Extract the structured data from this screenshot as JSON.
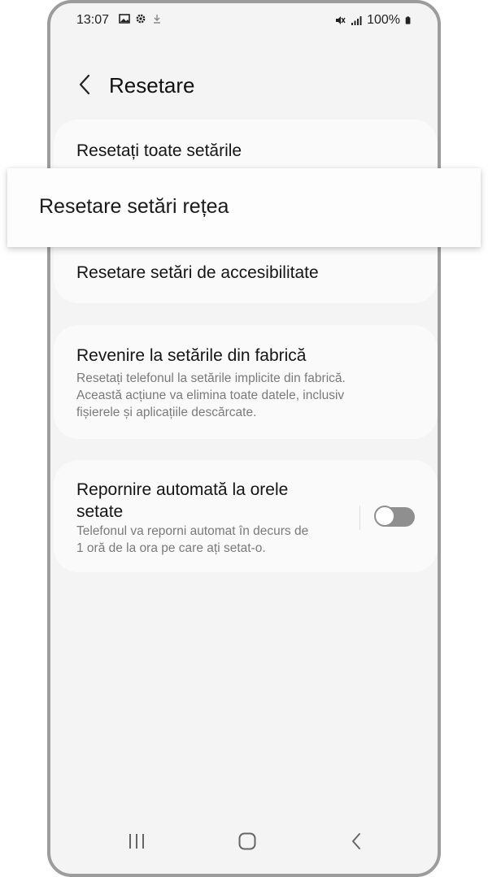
{
  "status_bar": {
    "time": "13:07",
    "battery": "100%",
    "icons_left": [
      "gallery-icon",
      "settings-icon",
      "download-icon"
    ],
    "icons_right": [
      "mute-icon",
      "signal-icon",
      "battery-icon"
    ]
  },
  "header": {
    "title": "Resetare"
  },
  "reset_items": {
    "all_settings": "Resetați toate setările",
    "network_settings": "Resetare setări rețea",
    "accessibility_settings": "Resetare setări de accesibilitate"
  },
  "factory_reset": {
    "title": "Revenire la setările din fabrică",
    "description_lines": [
      "Resetați telefonul la setările implicite din fabrică.",
      "Această acțiune va elimina toate datele, inclusiv",
      "fișierele și aplicațiile descărcate."
    ]
  },
  "auto_restart": {
    "title_lines": [
      "Repornire automată la orele",
      "setate"
    ],
    "description_lines": [
      "Telefonul va reporni automat în decurs de",
      "1 oră de la ora pe care ați setat-o."
    ],
    "toggle_on": false
  },
  "colors": {
    "background": "#f4f4f4",
    "card": "#fafafa",
    "toggle_off": "#8f8f8f"
  }
}
